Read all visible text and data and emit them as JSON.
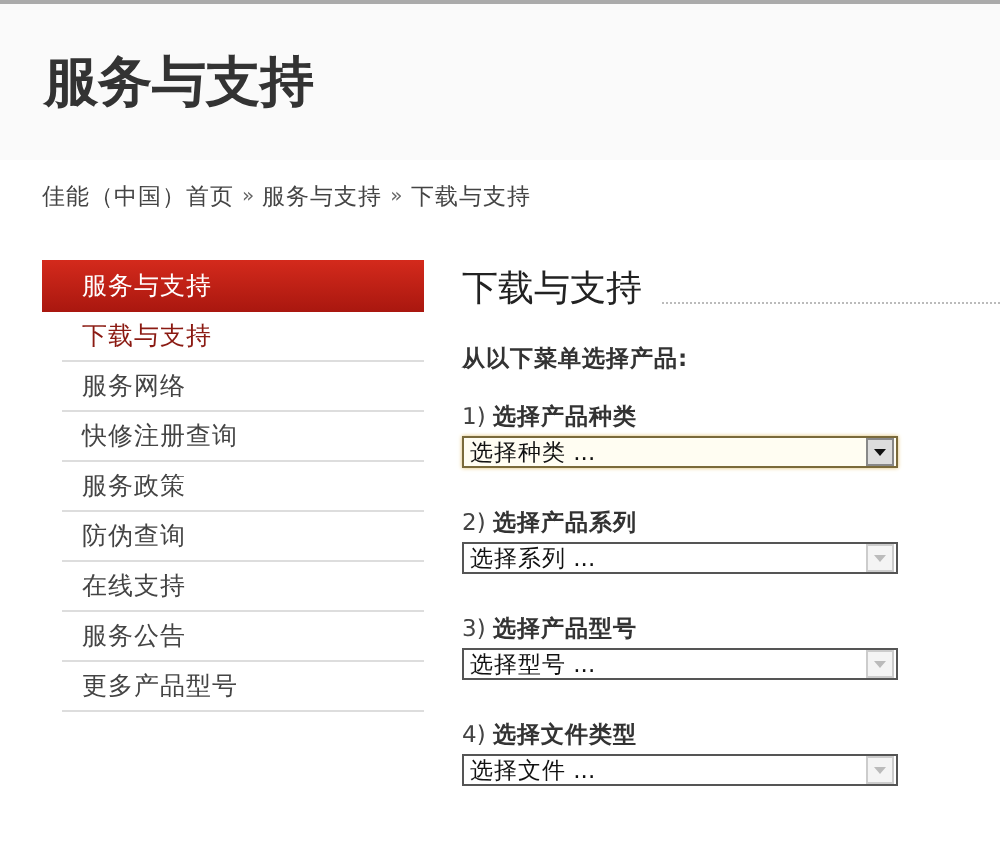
{
  "header": {
    "title": "服务与支持"
  },
  "breadcrumb": [
    "佳能（中国）首页",
    "服务与支持",
    "下载与支持"
  ],
  "breadcrumb_separator": "»",
  "sidebar": {
    "title": "服务与支持",
    "items": [
      {
        "label": "下载与支持",
        "selected": true
      },
      {
        "label": "服务网络",
        "selected": false
      },
      {
        "label": "快修注册查询",
        "selected": false
      },
      {
        "label": "服务政策",
        "selected": false
      },
      {
        "label": "防伪查询",
        "selected": false
      },
      {
        "label": "在线支持",
        "selected": false
      },
      {
        "label": "服务公告",
        "selected": false
      },
      {
        "label": "更多产品型号",
        "selected": false
      }
    ]
  },
  "content": {
    "heading": "下载与支持",
    "instruction": "从以下菜单选择产品:",
    "selects": [
      {
        "label": "1) **选择产品种类**",
        "value": "选择种类 ...",
        "disabled": false
      },
      {
        "label": "2) **选择产品系列**",
        "value": "选择系列 ...",
        "disabled": true
      },
      {
        "label": "3) **选择产品型号**",
        "value": "选择型号 ...",
        "disabled": true
      },
      {
        "label": "4) **选择文件类型**",
        "value": "选择文件 ...",
        "disabled": true
      }
    ]
  }
}
